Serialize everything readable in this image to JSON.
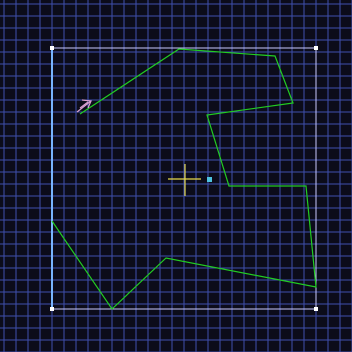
{
  "app": {
    "name": ""
  },
  "colors": {
    "background": "#0c0c1a",
    "grid": "#3f4fae",
    "selection_box": "#c8c8ff",
    "selection_handle": "#ffffff",
    "polyline": "#22cc22",
    "selected_edge": "#78b4ff",
    "cursor_cross": "#e6d84a",
    "pivot": "#4ec3e0",
    "pointer": "#d8a0d0"
  },
  "canvas": {
    "grid": "on",
    "icons": {
      "pivot": "pivot-point-icon",
      "cursor": "crosshair-cursor-icon",
      "pointer": "arrow-pointer-icon"
    }
  }
}
